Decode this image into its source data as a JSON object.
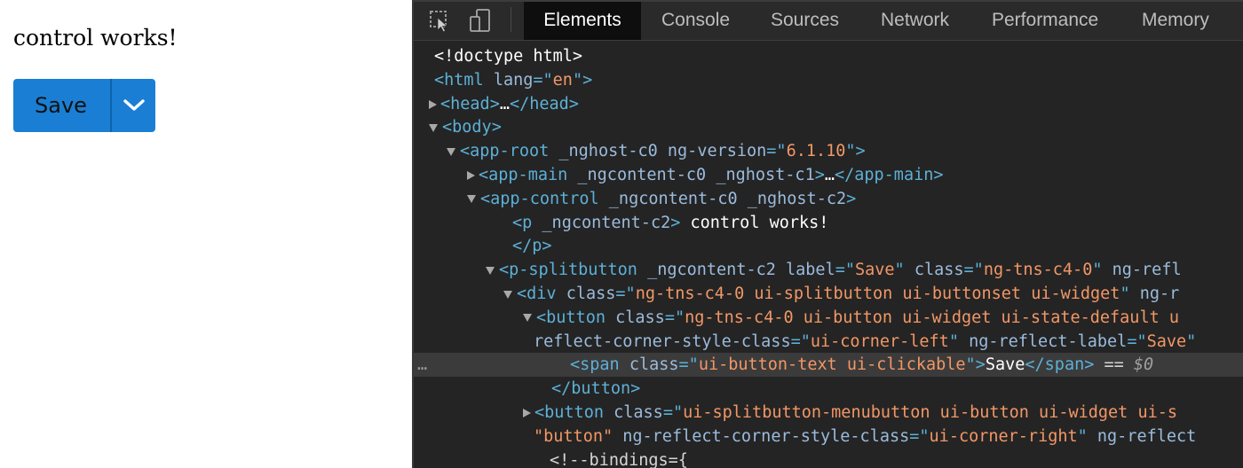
{
  "app": {
    "message": "control works!",
    "splitbutton": {
      "label": "Save",
      "menu_icon": "chevron-down-icon"
    }
  },
  "devtools": {
    "tools": [
      "inspect-element-icon",
      "device-toolbar-icon"
    ],
    "tabs": [
      {
        "label": "Elements",
        "active": true
      },
      {
        "label": "Console",
        "active": false
      },
      {
        "label": "Sources",
        "active": false
      },
      {
        "label": "Network",
        "active": false
      },
      {
        "label": "Performance",
        "active": false
      },
      {
        "label": "Memory",
        "active": false
      }
    ],
    "dom_lines": [
      {
        "toggle": "none",
        "tokens": [
          {
            "c": "txt",
            "t": "<!doctype html>"
          }
        ]
      },
      {
        "toggle": "none",
        "tokens": [
          {
            "c": "tag",
            "t": "<html "
          },
          {
            "c": "attr",
            "t": "lang"
          },
          {
            "c": "tag",
            "t": "=\""
          },
          {
            "c": "val",
            "t": "en"
          },
          {
            "c": "tag",
            "t": "\">"
          }
        ]
      },
      {
        "toggle": "right",
        "tokens": [
          {
            "c": "tag",
            "t": "<head>"
          },
          {
            "c": "txt",
            "t": "…"
          },
          {
            "c": "tag",
            "t": "</head>"
          }
        ]
      },
      {
        "toggle": "down",
        "tokens": [
          {
            "c": "tag",
            "t": "<body>"
          }
        ]
      },
      {
        "toggle": "down",
        "tokens": [
          {
            "c": "tag",
            "t": "<app-root "
          },
          {
            "c": "attr",
            "t": "_nghost-c0 ng-version"
          },
          {
            "c": "tag",
            "t": "=\""
          },
          {
            "c": "val",
            "t": "6.1.10"
          },
          {
            "c": "tag",
            "t": "\">"
          }
        ]
      },
      {
        "toggle": "right",
        "tokens": [
          {
            "c": "tag",
            "t": "<app-main "
          },
          {
            "c": "attr",
            "t": "_ngcontent-c0 _nghost-c1"
          },
          {
            "c": "tag",
            "t": ">"
          },
          {
            "c": "txt",
            "t": "…"
          },
          {
            "c": "tag",
            "t": "</app-main>"
          }
        ]
      },
      {
        "toggle": "down",
        "tokens": [
          {
            "c": "tag",
            "t": "<app-control "
          },
          {
            "c": "attr",
            "t": "_ngcontent-c0 _nghost-c2"
          },
          {
            "c": "tag",
            "t": ">"
          }
        ]
      },
      {
        "toggle": "none",
        "tokens": [
          {
            "c": "tag",
            "t": "<p "
          },
          {
            "c": "attr",
            "t": "_ngcontent-c2"
          },
          {
            "c": "tag",
            "t": ">"
          },
          {
            "c": "txt",
            "t": " control works!"
          }
        ]
      },
      {
        "toggle": "none",
        "tokens": [
          {
            "c": "tag",
            "t": "</p>"
          }
        ]
      },
      {
        "toggle": "down",
        "tokens": [
          {
            "c": "tag",
            "t": "<p-splitbutton "
          },
          {
            "c": "attr",
            "t": "_ngcontent-c2 label"
          },
          {
            "c": "tag",
            "t": "=\""
          },
          {
            "c": "val",
            "t": "Save"
          },
          {
            "c": "tag",
            "t": "\" "
          },
          {
            "c": "attr",
            "t": "class"
          },
          {
            "c": "tag",
            "t": "=\""
          },
          {
            "c": "val",
            "t": "ng-tns-c4-0"
          },
          {
            "c": "tag",
            "t": "\" "
          },
          {
            "c": "attr",
            "t": "ng-refl"
          }
        ]
      },
      {
        "toggle": "down",
        "tokens": [
          {
            "c": "tag",
            "t": "<div "
          },
          {
            "c": "attr",
            "t": "class"
          },
          {
            "c": "tag",
            "t": "=\""
          },
          {
            "c": "val",
            "t": "ng-tns-c4-0 ui-splitbutton ui-buttonset ui-widget"
          },
          {
            "c": "tag",
            "t": "\" "
          },
          {
            "c": "attr",
            "t": "ng-r"
          }
        ]
      },
      {
        "toggle": "down",
        "tokens": [
          {
            "c": "tag",
            "t": "<button "
          },
          {
            "c": "attr",
            "t": "class"
          },
          {
            "c": "tag",
            "t": "=\""
          },
          {
            "c": "val",
            "t": "ng-tns-c4-0 ui-button ui-widget ui-state-default u"
          }
        ]
      },
      {
        "toggle": "none",
        "tokens": [
          {
            "c": "attr",
            "t": "reflect-corner-style-class"
          },
          {
            "c": "tag",
            "t": "=\""
          },
          {
            "c": "val",
            "t": "ui-corner-left"
          },
          {
            "c": "tag",
            "t": "\" "
          },
          {
            "c": "attr",
            "t": "ng-reflect-label"
          },
          {
            "c": "tag",
            "t": "=\""
          },
          {
            "c": "val",
            "t": "Save"
          },
          {
            "c": "tag",
            "t": "\""
          }
        ]
      },
      {
        "toggle": "none",
        "selected": true,
        "tokens": [
          {
            "c": "tag",
            "t": "<span "
          },
          {
            "c": "attr",
            "t": "class"
          },
          {
            "c": "tag",
            "t": "=\""
          },
          {
            "c": "val",
            "t": "ui-button-text ui-clickable"
          },
          {
            "c": "tag",
            "t": "\">"
          },
          {
            "c": "txt",
            "t": "Save"
          },
          {
            "c": "tag",
            "t": "</span>"
          },
          {
            "c": "plain",
            "t": " == "
          },
          {
            "c": "dollar",
            "t": "$0"
          }
        ]
      },
      {
        "toggle": "none",
        "tokens": [
          {
            "c": "tag",
            "t": "</button>"
          }
        ]
      },
      {
        "toggle": "right",
        "tokens": [
          {
            "c": "tag",
            "t": "<button "
          },
          {
            "c": "attr",
            "t": "class"
          },
          {
            "c": "tag",
            "t": "=\""
          },
          {
            "c": "val",
            "t": "ui-splitbutton-menubutton ui-button ui-widget ui-s"
          }
        ]
      },
      {
        "toggle": "none",
        "tokens": [
          {
            "c": "val",
            "t": "\"button\" "
          },
          {
            "c": "attr",
            "t": "ng-reflect-corner-style-class"
          },
          {
            "c": "tag",
            "t": "=\""
          },
          {
            "c": "val",
            "t": "ui-corner-right"
          },
          {
            "c": "tag",
            "t": "\" "
          },
          {
            "c": "attr",
            "t": "ng-reflect"
          }
        ]
      },
      {
        "toggle": "none",
        "tokens": [
          {
            "c": "plain",
            "t": "<!--bindings={"
          }
        ]
      }
    ],
    "selected_gutter": "…"
  }
}
